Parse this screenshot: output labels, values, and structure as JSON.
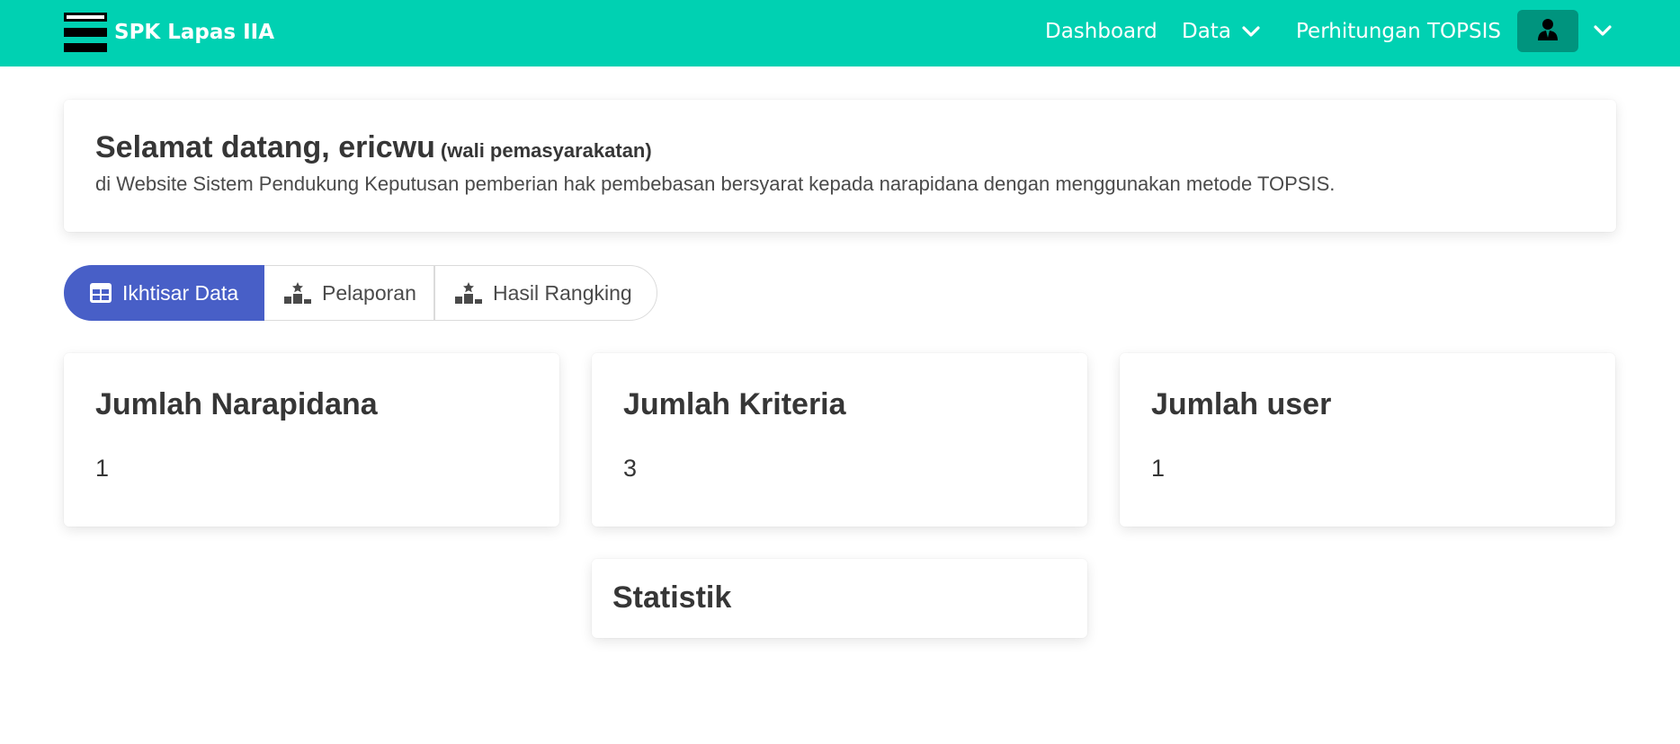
{
  "navbar": {
    "brand": "SPK Lapas IIA",
    "links": {
      "dashboard": "Dashboard",
      "data": "Data",
      "topsis": "Perhitungan TOPSIS"
    },
    "icons": {
      "logo": "menu-bars-icon",
      "chevron": "chevron-down-icon",
      "user": "user-icon"
    },
    "color": "#00d1b2",
    "user_button_color": "#00947e"
  },
  "welcome": {
    "title": "Selamat datang, ericwu",
    "role": "(wali pemasyarakatan)",
    "subtitle": "di Website Sistem Pendukung Keputusan pemberian hak pembebasan bersyarat kepada narapidana dengan menggunakan metode TOPSIS."
  },
  "tabs": [
    {
      "label": "Ikhtisar Data",
      "icon": "table-icon",
      "active": true
    },
    {
      "label": "Pelaporan",
      "icon": "podium-icon",
      "active": false
    },
    {
      "label": "Hasil Rangking",
      "icon": "podium-icon",
      "active": false
    }
  ],
  "tab_active_color": "#485fc7",
  "stats": [
    {
      "title": "Jumlah Narapidana",
      "value": "1"
    },
    {
      "title": "Jumlah Kriteria",
      "value": "3"
    },
    {
      "title": "Jumlah user",
      "value": "1"
    }
  ],
  "statistik": {
    "title": "Statistik"
  }
}
